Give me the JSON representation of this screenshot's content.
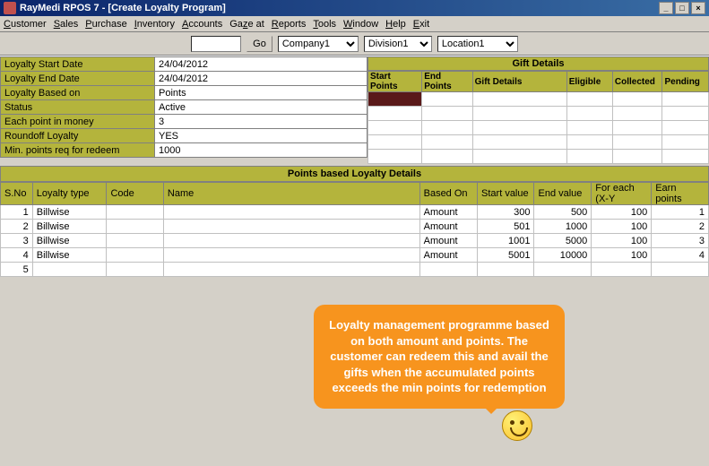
{
  "title": "RayMedi RPOS 7 - [Create Loyalty Program]",
  "menu": [
    "Customer",
    "Sales",
    "Purchase",
    "Inventory",
    "Accounts",
    "Gaze at",
    "Reports",
    "Tools",
    "Window",
    "Help",
    "Exit"
  ],
  "toolbar": {
    "go": "Go",
    "company": "Company1",
    "division": "Division1",
    "location": "Location1"
  },
  "form": {
    "rows": [
      {
        "label": "Loyalty Start Date",
        "value": "24/04/2012"
      },
      {
        "label": "Loyalty End Date",
        "value": "24/04/2012"
      },
      {
        "label": "Loyalty Based on",
        "value": "Points"
      },
      {
        "label": "Status",
        "value": "Active"
      },
      {
        "label": "Each point in money",
        "value": "3"
      },
      {
        "label": "Roundoff Loyalty",
        "value": "YES"
      },
      {
        "label": "Min. points req for redeem",
        "value": "1000"
      }
    ]
  },
  "gift": {
    "title": "Gift Details",
    "cols": [
      "Start Points",
      "End Points",
      "Gift Details",
      "Eligible",
      "Collected",
      "Pending"
    ]
  },
  "pbl": {
    "title": "Points based Loyalty Details",
    "cols": [
      "S.No",
      "Loyalty type",
      "Code",
      "Name",
      "Based On",
      "Start value",
      "End value",
      "For each (X-Y",
      "Earn points"
    ],
    "rows": [
      {
        "sno": "1",
        "type": "Billwise",
        "code": "",
        "name": "",
        "based": "Amount",
        "sv": "300",
        "ev": "500",
        "fe": "100",
        "ep": "1"
      },
      {
        "sno": "2",
        "type": "Billwise",
        "code": "",
        "name": "",
        "based": "Amount",
        "sv": "501",
        "ev": "1000",
        "fe": "100",
        "ep": "2"
      },
      {
        "sno": "3",
        "type": "Billwise",
        "code": "",
        "name": "",
        "based": "Amount",
        "sv": "1001",
        "ev": "5000",
        "fe": "100",
        "ep": "3"
      },
      {
        "sno": "4",
        "type": "Billwise",
        "code": "",
        "name": "",
        "based": "Amount",
        "sv": "5001",
        "ev": "10000",
        "fe": "100",
        "ep": "4"
      },
      {
        "sno": "5",
        "type": "",
        "code": "",
        "name": "",
        "based": "",
        "sv": "",
        "ev": "",
        "fe": "",
        "ep": ""
      }
    ]
  },
  "callout": "Loyalty management programme based on both amount and points. The customer can redeem this and avail the gifts when the accumulated points exceeds the min points for redemption"
}
